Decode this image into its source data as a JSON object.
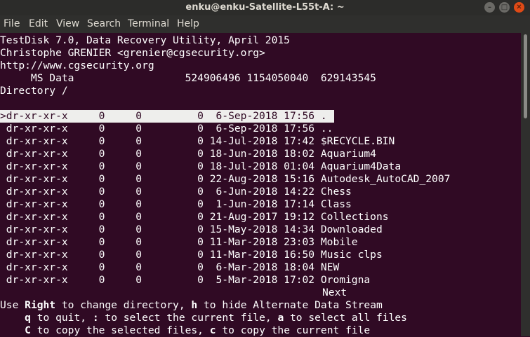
{
  "window": {
    "title": "enku@enku-Satellite-L55t-A: ~"
  },
  "menu": [
    "File",
    "Edit",
    "View",
    "Search",
    "Terminal",
    "Help"
  ],
  "header": {
    "line1": "TestDisk 7.0, Data Recovery Utility, April 2015",
    "line2": "Christophe GRENIER <grenier@cgsecurity.org>",
    "line3": "http://www.cgsecurity.org",
    "partition": "     MS Data                  524906496 1154050040  629143545",
    "directory": "Directory /"
  },
  "entries": [
    ">dr-xr-xr-x     0     0         0  6-Sep-2018 17:56 .",
    " dr-xr-xr-x     0     0         0  6-Sep-2018 17:56 ..",
    " dr-xr-xr-x     0     0         0 14-Jul-2018 17:42 $RECYCLE.BIN",
    " dr-xr-xr-x     0     0         0 18-Jun-2018 18:02 Aquarium4",
    " dr-xr-xr-x     0     0         0 18-Jul-2018 01:04 Aquarium4Data",
    " dr-xr-xr-x     0     0         0 22-Aug-2018 15:16 Autodesk_AutoCAD_2007",
    " dr-xr-xr-x     0     0         0  6-Jun-2018 14:22 Chess",
    " dr-xr-xr-x     0     0         0  1-Jun-2018 17:14 Class",
    " dr-xr-xr-x     0     0         0 21-Aug-2017 19:12 Collections",
    " dr-xr-xr-x     0     0         0 15-May-2018 14:34 Downloaded",
    " dr-xr-xr-x     0     0         0 11-Mar-2018 23:03 Mobile",
    " dr-xr-xr-x     0     0         0 11-Mar-2018 16:50 Music clps",
    " dr-xr-xr-x     0     0         0  6-Mar-2018 18:04 NEW",
    " dr-xr-xr-x     0     0         0  5-Mar-2018 17:02 Oromigna"
  ],
  "next_label": "Next",
  "help": {
    "l1_a": "Use ",
    "l1_key1": "Right",
    "l1_b": " to change directory, ",
    "l1_key2": "h",
    "l1_c": " to hide Alternate Data Stream",
    "l2_pre": "    ",
    "l2_key1": "q",
    "l2_a": " to quit, ",
    "l2_key2": ":",
    "l2_b": " to select the current file, ",
    "l2_key3": "a",
    "l2_c": " to select all files",
    "l3_pre": "    ",
    "l3_key1": "C",
    "l3_a": " to copy the selected files, ",
    "l3_key2": "c",
    "l3_b": " to copy the current file"
  }
}
